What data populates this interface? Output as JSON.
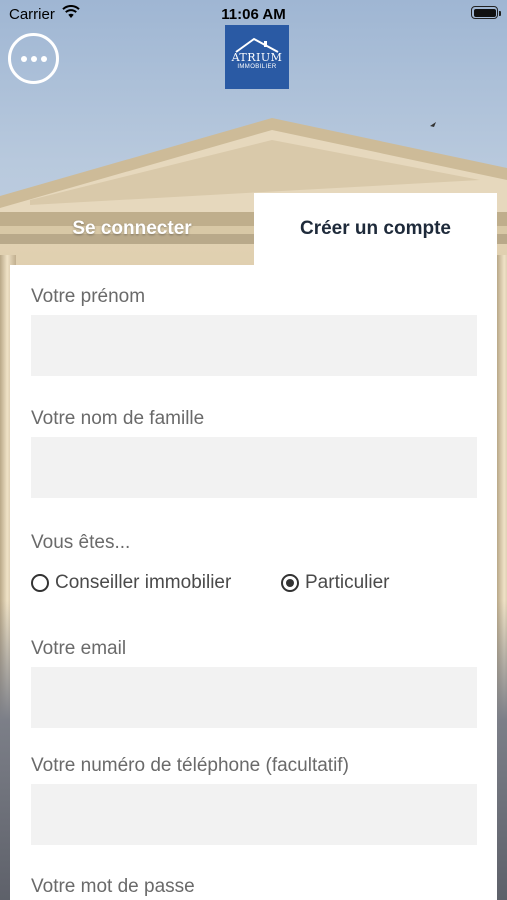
{
  "status_bar": {
    "carrier": "Carrier",
    "time": "11:06 AM",
    "wifi_icon": "wifi-icon",
    "battery_icon": "battery-icon"
  },
  "header": {
    "menu_icon": "more-horizontal-icon",
    "logo": {
      "brand": "ATRIUM",
      "subtitle": "IMMOBILIER",
      "color": "#2a5aa4"
    }
  },
  "tabs": [
    {
      "label": "Se connecter",
      "active": false
    },
    {
      "label": "Créer un compte",
      "active": true
    }
  ],
  "form": {
    "first_name": {
      "label": "Votre prénom",
      "value": "",
      "placeholder": ""
    },
    "last_name": {
      "label": "Votre nom de famille",
      "value": "",
      "placeholder": ""
    },
    "user_type": {
      "label": "Vous êtes...",
      "options": [
        {
          "label": "Conseiller immobilier",
          "selected": false
        },
        {
          "label": "Particulier",
          "selected": true
        }
      ]
    },
    "email": {
      "label": "Votre email",
      "value": "",
      "placeholder": ""
    },
    "phone": {
      "label": "Votre numéro de téléphone (facultatif)",
      "value": "",
      "placeholder": ""
    },
    "password": {
      "label": "Votre mot de passe"
    }
  },
  "colors": {
    "panel_bg": "#ffffff",
    "field_bg": "#f2f2f2",
    "label_text": "#6a6a6a",
    "active_tab_text": "#1e2a3a"
  }
}
